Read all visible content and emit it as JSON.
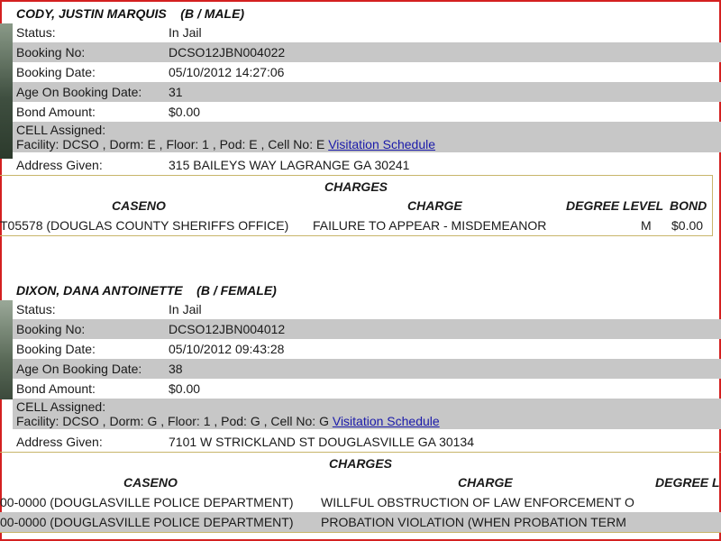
{
  "labels": {
    "status": "Status:",
    "booking_no": "Booking No:",
    "booking_date": "Booking Date:",
    "age": "Age On Booking Date:",
    "bond": "Bond Amount:",
    "cell": "CELL Assigned:",
    "address": "Address Given:",
    "charges": "CHARGES",
    "caseno": "CASENO",
    "charge": "CHARGE",
    "degree_level": "DEGREE LEVEL",
    "degree_trunc": "DEGREE L",
    "bond_col": "BOND",
    "visitation": "Visitation Schedule"
  },
  "inmates": [
    {
      "name": "CODY, JUSTIN MARQUIS",
      "race_sex": "(B / MALE)",
      "status": "In Jail",
      "booking_no": "DCSO12JBN004022",
      "booking_date": "05/10/2012 14:27:06",
      "age": "31",
      "bond": "$0.00",
      "cell_line": "Facility: DCSO , Dorm: E , Floor: 1 , Pod: E , Cell No: E",
      "address": "315 BAILEYS WAY LAGRANGE GA 30241",
      "charges": [
        {
          "caseno": "T05578 (DOUGLAS COUNTY SHERIFFS OFFICE)",
          "charge": "FAILURE TO APPEAR - MISDEMEANOR",
          "degree": "M",
          "bond": "$0.00"
        }
      ]
    },
    {
      "name": "DIXON, DANA ANTOINETTE",
      "race_sex": "(B / FEMALE)",
      "status": "In Jail",
      "booking_no": "DCSO12JBN004012",
      "booking_date": "05/10/2012 09:43:28",
      "age": "38",
      "bond": "$0.00",
      "cell_line": "Facility: DCSO , Dorm: G , Floor: 1 , Pod: G , Cell No: G",
      "address": "7101 W STRICKLAND ST DOUGLASVILLE GA 30134",
      "charges": [
        {
          "caseno": "00-0000 (DOUGLASVILLE POLICE DEPARTMENT)",
          "charge": "WILLFUL OBSTRUCTION OF LAW ENFORCEMENT O"
        },
        {
          "caseno": "00-0000 (DOUGLASVILLE POLICE DEPARTMENT)",
          "charge": "PROBATION VIOLATION (WHEN PROBATION TERM"
        }
      ]
    }
  ]
}
